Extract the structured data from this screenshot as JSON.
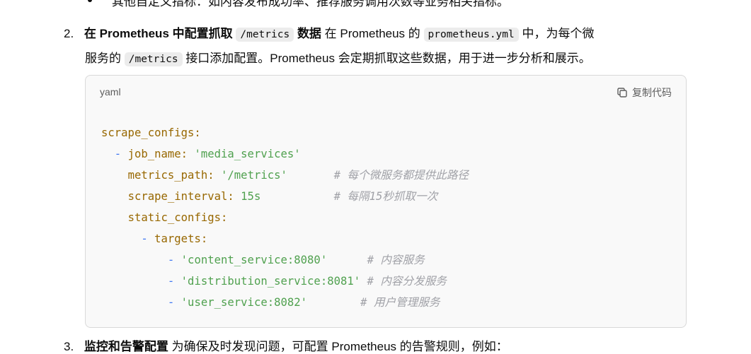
{
  "prev_bullet": {
    "bold": "其他自定义指标",
    "text": "：如内容发布成功率、推荐服务调用次数等业务相关指标。"
  },
  "item2": {
    "number": "2.",
    "bold1": "在 Prometheus 中配置抓取",
    "code1": "/metrics",
    "bold2": "数据",
    "text1": "在 Prometheus 的",
    "code2": "prometheus.yml",
    "text2": "中，为每个微",
    "line2_text1": "服务的",
    "code3": "/metrics",
    "line2_text2": "接口添加配置。Prometheus 会定期抓取这些数据，用于进一步分析和展示。"
  },
  "code_block": {
    "language": "yaml",
    "copy_label": "复制代码",
    "lines": [
      [
        [
          "k",
          "scrape_configs:"
        ]
      ],
      [
        [
          "p",
          "  "
        ],
        [
          "d",
          "-"
        ],
        [
          "p",
          " "
        ],
        [
          "k",
          "job_name:"
        ],
        [
          "p",
          " "
        ],
        [
          "s",
          "'media_services'"
        ]
      ],
      [
        [
          "p",
          "    "
        ],
        [
          "k",
          "metrics_path:"
        ],
        [
          "p",
          " "
        ],
        [
          "s",
          "'/metrics'"
        ],
        [
          "p",
          "       "
        ],
        [
          "c",
          "# 每个微服务都提供此路径"
        ]
      ],
      [
        [
          "p",
          "    "
        ],
        [
          "k",
          "scrape_interval:"
        ],
        [
          "p",
          " "
        ],
        [
          "s",
          "15s"
        ],
        [
          "p",
          "           "
        ],
        [
          "c",
          "# 每隔15秒抓取一次"
        ]
      ],
      [
        [
          "p",
          "    "
        ],
        [
          "k",
          "static_configs:"
        ]
      ],
      [
        [
          "p",
          "      "
        ],
        [
          "d",
          "-"
        ],
        [
          "p",
          " "
        ],
        [
          "k",
          "targets:"
        ]
      ],
      [
        [
          "p",
          "          "
        ],
        [
          "d",
          "-"
        ],
        [
          "p",
          " "
        ],
        [
          "s",
          "'content_service:8080'"
        ],
        [
          "p",
          "      "
        ],
        [
          "c",
          "# 内容服务"
        ]
      ],
      [
        [
          "p",
          "          "
        ],
        [
          "d",
          "-"
        ],
        [
          "p",
          " "
        ],
        [
          "s",
          "'distribution_service:8081'"
        ],
        [
          "p",
          " "
        ],
        [
          "c",
          "# 内容分发服务"
        ]
      ],
      [
        [
          "p",
          "          "
        ],
        [
          "d",
          "-"
        ],
        [
          "p",
          " "
        ],
        [
          "s",
          "'user_service:8082'"
        ],
        [
          "p",
          "        "
        ],
        [
          "c",
          "# 用户管理服务"
        ]
      ]
    ]
  },
  "item3": {
    "number": "3.",
    "bold": "监控和告警配置",
    "text": "为确保及时发现问题，可配置 Prometheus 的告警规则，例如："
  }
}
